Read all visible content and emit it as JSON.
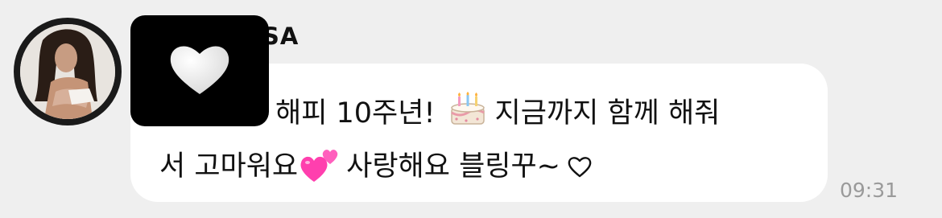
{
  "message": {
    "sender_visible": "SA",
    "line1_text_before": "해피 10주년!",
    "line1_text_after": "지금까지 함께 해줘",
    "line2_text_before": "서 고마워요",
    "line2_text_after": "사랑해요 블링꾸~",
    "time": "09:31"
  },
  "icons": {
    "censor_icon": "white-heart-icon",
    "cake_icon": "birthday-cake-icon",
    "hearts_icon": "two-hearts-icon",
    "heart_outline_icon": "white-heart-outline-icon"
  },
  "colors": {
    "background": "#efefef",
    "bubble": "#ffffff",
    "time": "#9a9a9a",
    "hearts": "#ff3fae"
  }
}
